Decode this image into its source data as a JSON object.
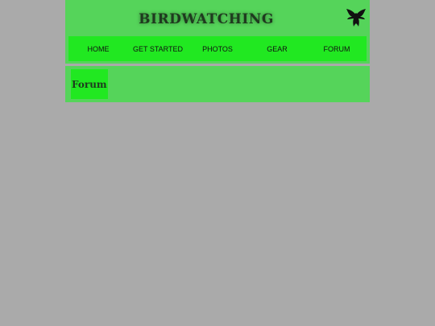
{
  "header": {
    "title": "BIRDWATCHING",
    "logo_icon": "bird-icon"
  },
  "nav": {
    "items": [
      {
        "label": "HOME"
      },
      {
        "label": "GET STARTED"
      },
      {
        "label": "PHOTOS"
      },
      {
        "label": "GEAR"
      },
      {
        "label": "FORUM"
      }
    ]
  },
  "main": {
    "heading": "Forum"
  },
  "colors": {
    "page_background": "#aaaaaa",
    "panel_green": "#55d45a",
    "accent_green": "#21e821"
  }
}
